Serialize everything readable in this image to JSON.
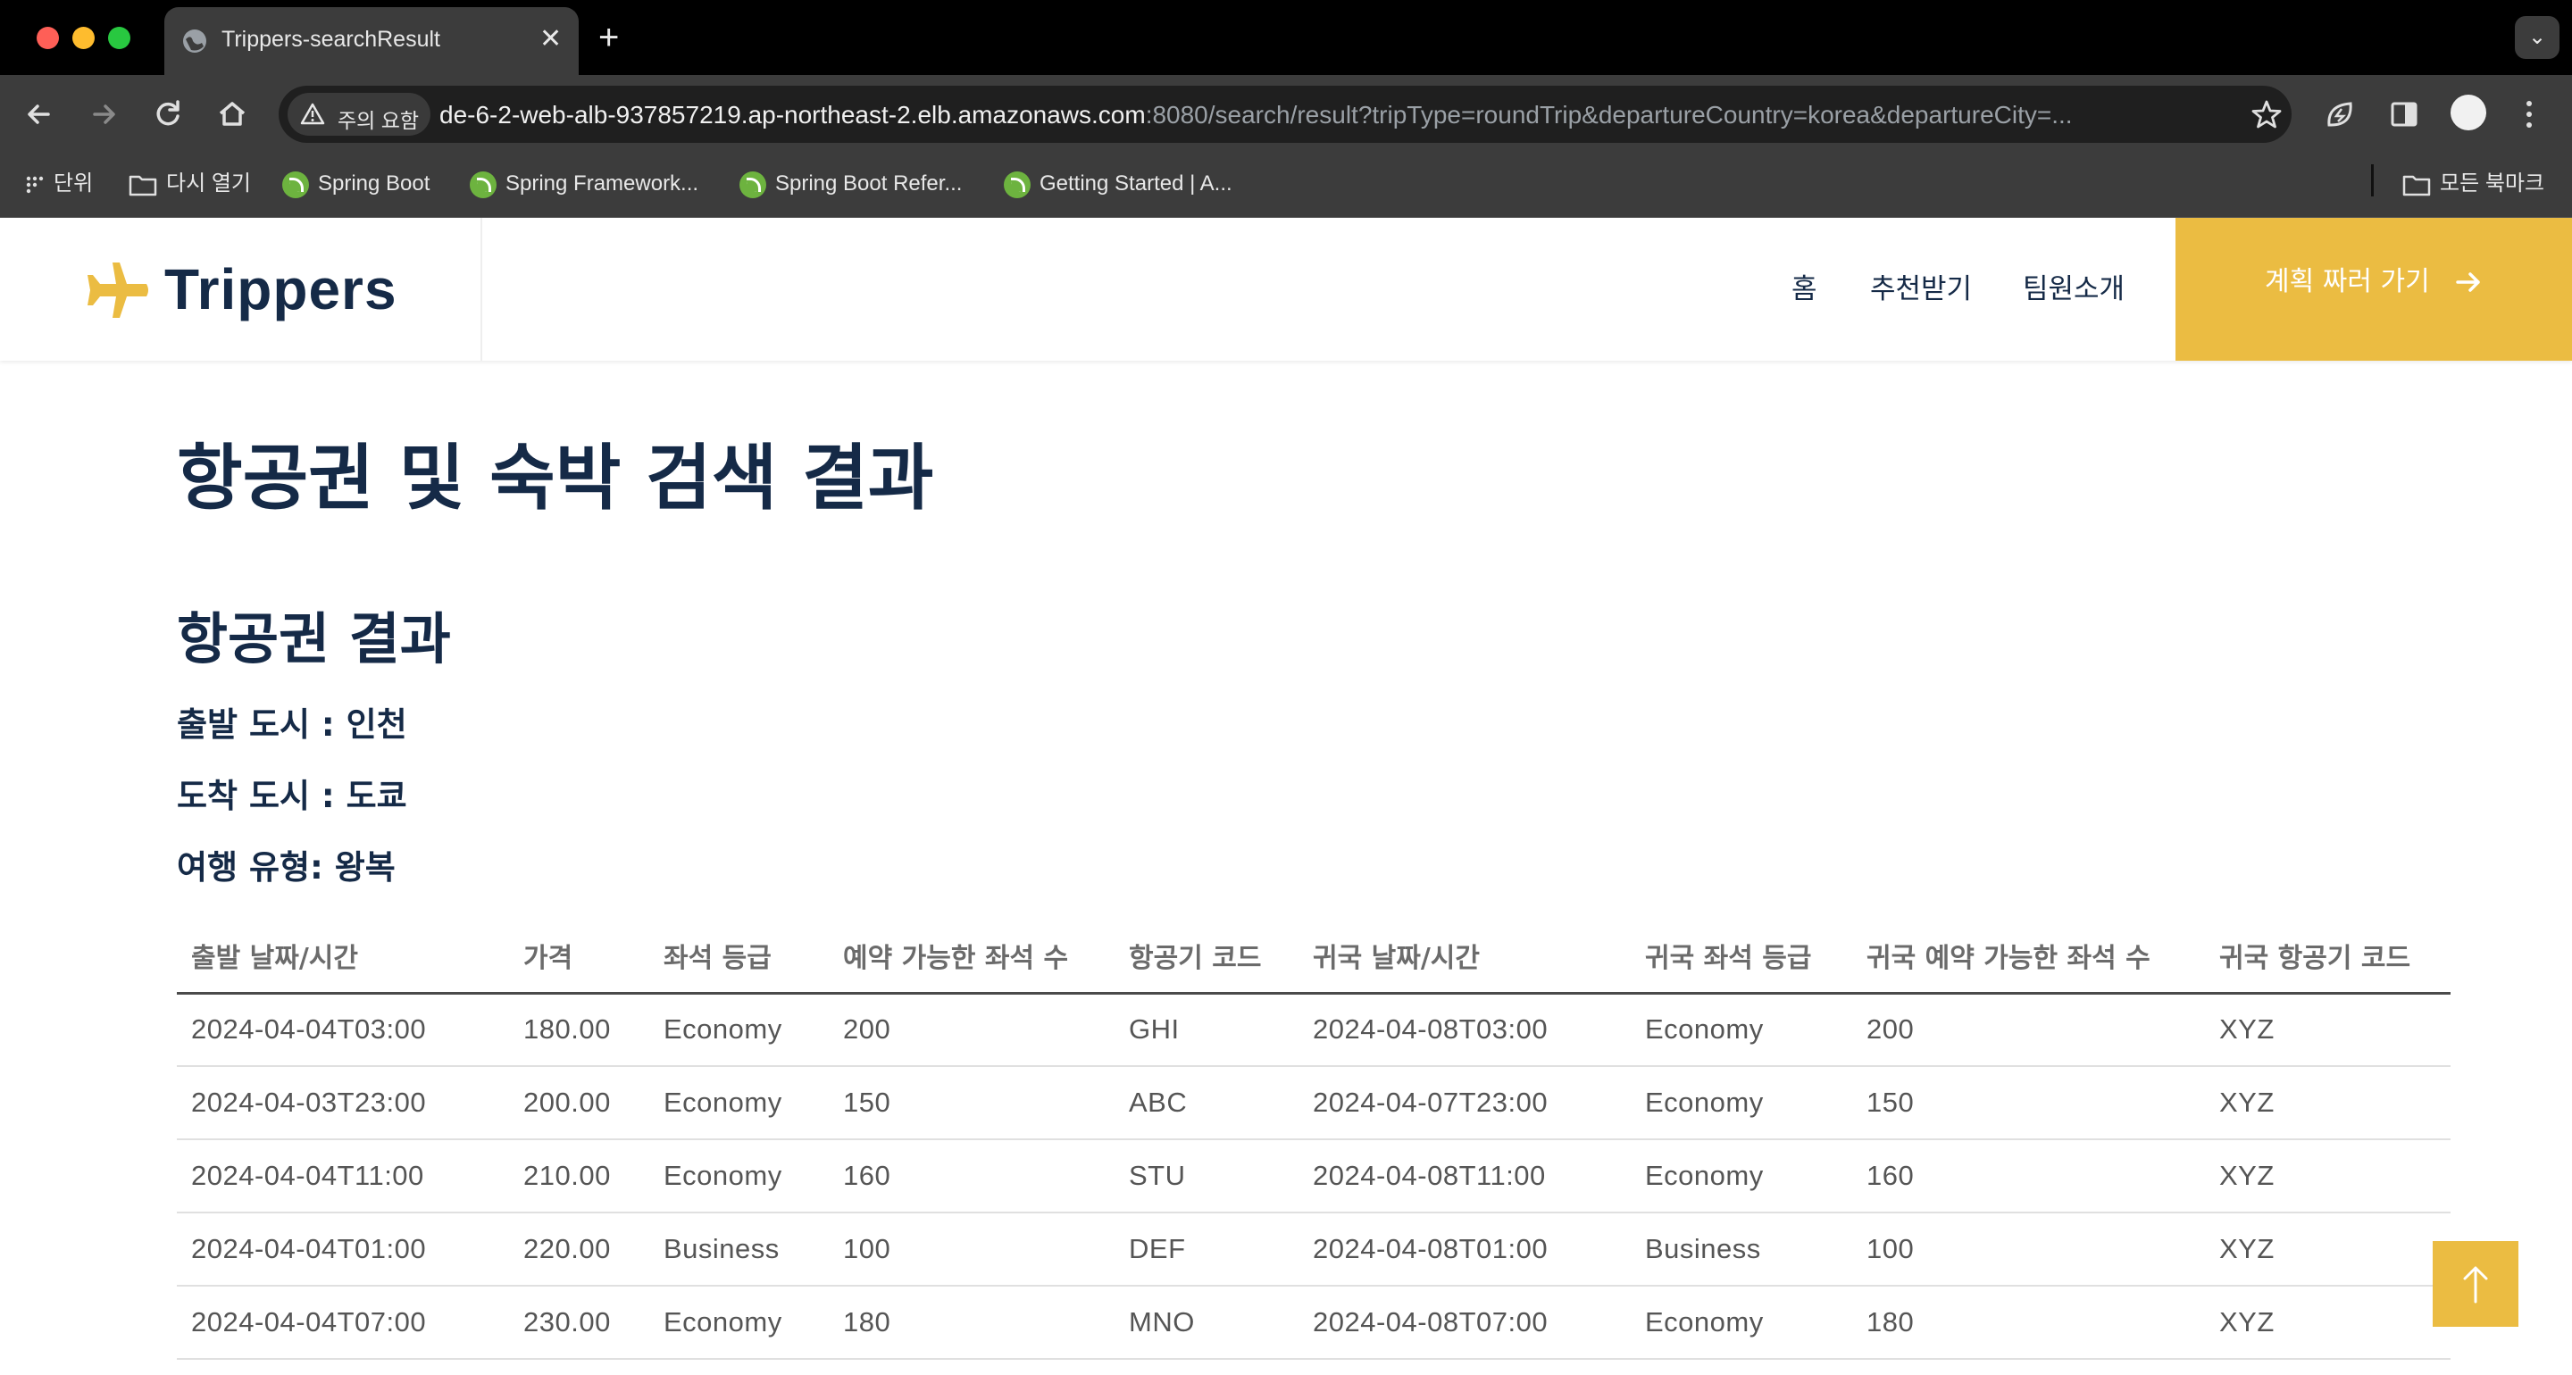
{
  "browser": {
    "tab_title": "Trippers-searchResult",
    "security_label": "주의 요함",
    "url_host": "de-6-2-web-alb-937857219.ap-northeast-2.elb.amazonaws.com",
    "url_rest": ":8080/search/result?tripType=roundTrip&departureCountry=korea&departureCity=...",
    "bookmarks": [
      {
        "label": "단위",
        "icon": "apps-grid-icon"
      },
      {
        "label": "다시 열기",
        "icon": "folder-icon"
      },
      {
        "label": "Spring Boot",
        "icon": "spring-leaf-icon"
      },
      {
        "label": "Spring Framework...",
        "icon": "spring-leaf-icon"
      },
      {
        "label": "Spring Boot Refer...",
        "icon": "spring-leaf-icon"
      },
      {
        "label": "Getting Started | A...",
        "icon": "spring-leaf-icon"
      }
    ],
    "all_bookmarks_label": "모든 북마크"
  },
  "header": {
    "brand": "Trippers",
    "nav": [
      {
        "label": "홈"
      },
      {
        "label": "추천받기"
      },
      {
        "label": "팀원소개"
      }
    ],
    "cta_label": "계획 짜러 가기",
    "accent_color": "#ebbc42",
    "text_color": "#152a47"
  },
  "main": {
    "page_title": "항공권 및 숙박 검색 결과",
    "section_title": "항공권 결과",
    "departure_city": "출발 도시 : 인천",
    "arrival_city": "도착 도시 : 도쿄",
    "trip_type": "여행 유형: 왕복",
    "table": {
      "headers": [
        "출발 날짜/시간",
        "가격",
        "좌석 등급",
        "예약 가능한 좌석 수",
        "항공기 코드",
        "귀국 날짜/시간",
        "귀국 좌석 등급",
        "귀국 예약 가능한 좌석 수",
        "귀국 항공기 코드"
      ],
      "rows": [
        [
          "2024-04-04T03:00",
          "180.00",
          "Economy",
          "200",
          "GHI",
          "2024-04-08T03:00",
          "Economy",
          "200",
          "XYZ"
        ],
        [
          "2024-04-03T23:00",
          "200.00",
          "Economy",
          "150",
          "ABC",
          "2024-04-07T23:00",
          "Economy",
          "150",
          "XYZ"
        ],
        [
          "2024-04-04T11:00",
          "210.00",
          "Economy",
          "160",
          "STU",
          "2024-04-08T11:00",
          "Economy",
          "160",
          "XYZ"
        ],
        [
          "2024-04-04T01:00",
          "220.00",
          "Business",
          "100",
          "DEF",
          "2024-04-08T01:00",
          "Business",
          "100",
          "XYZ"
        ],
        [
          "2024-04-04T07:00",
          "230.00",
          "Economy",
          "180",
          "MNO",
          "2024-04-08T07:00",
          "Economy",
          "180",
          "XYZ"
        ]
      ]
    }
  }
}
